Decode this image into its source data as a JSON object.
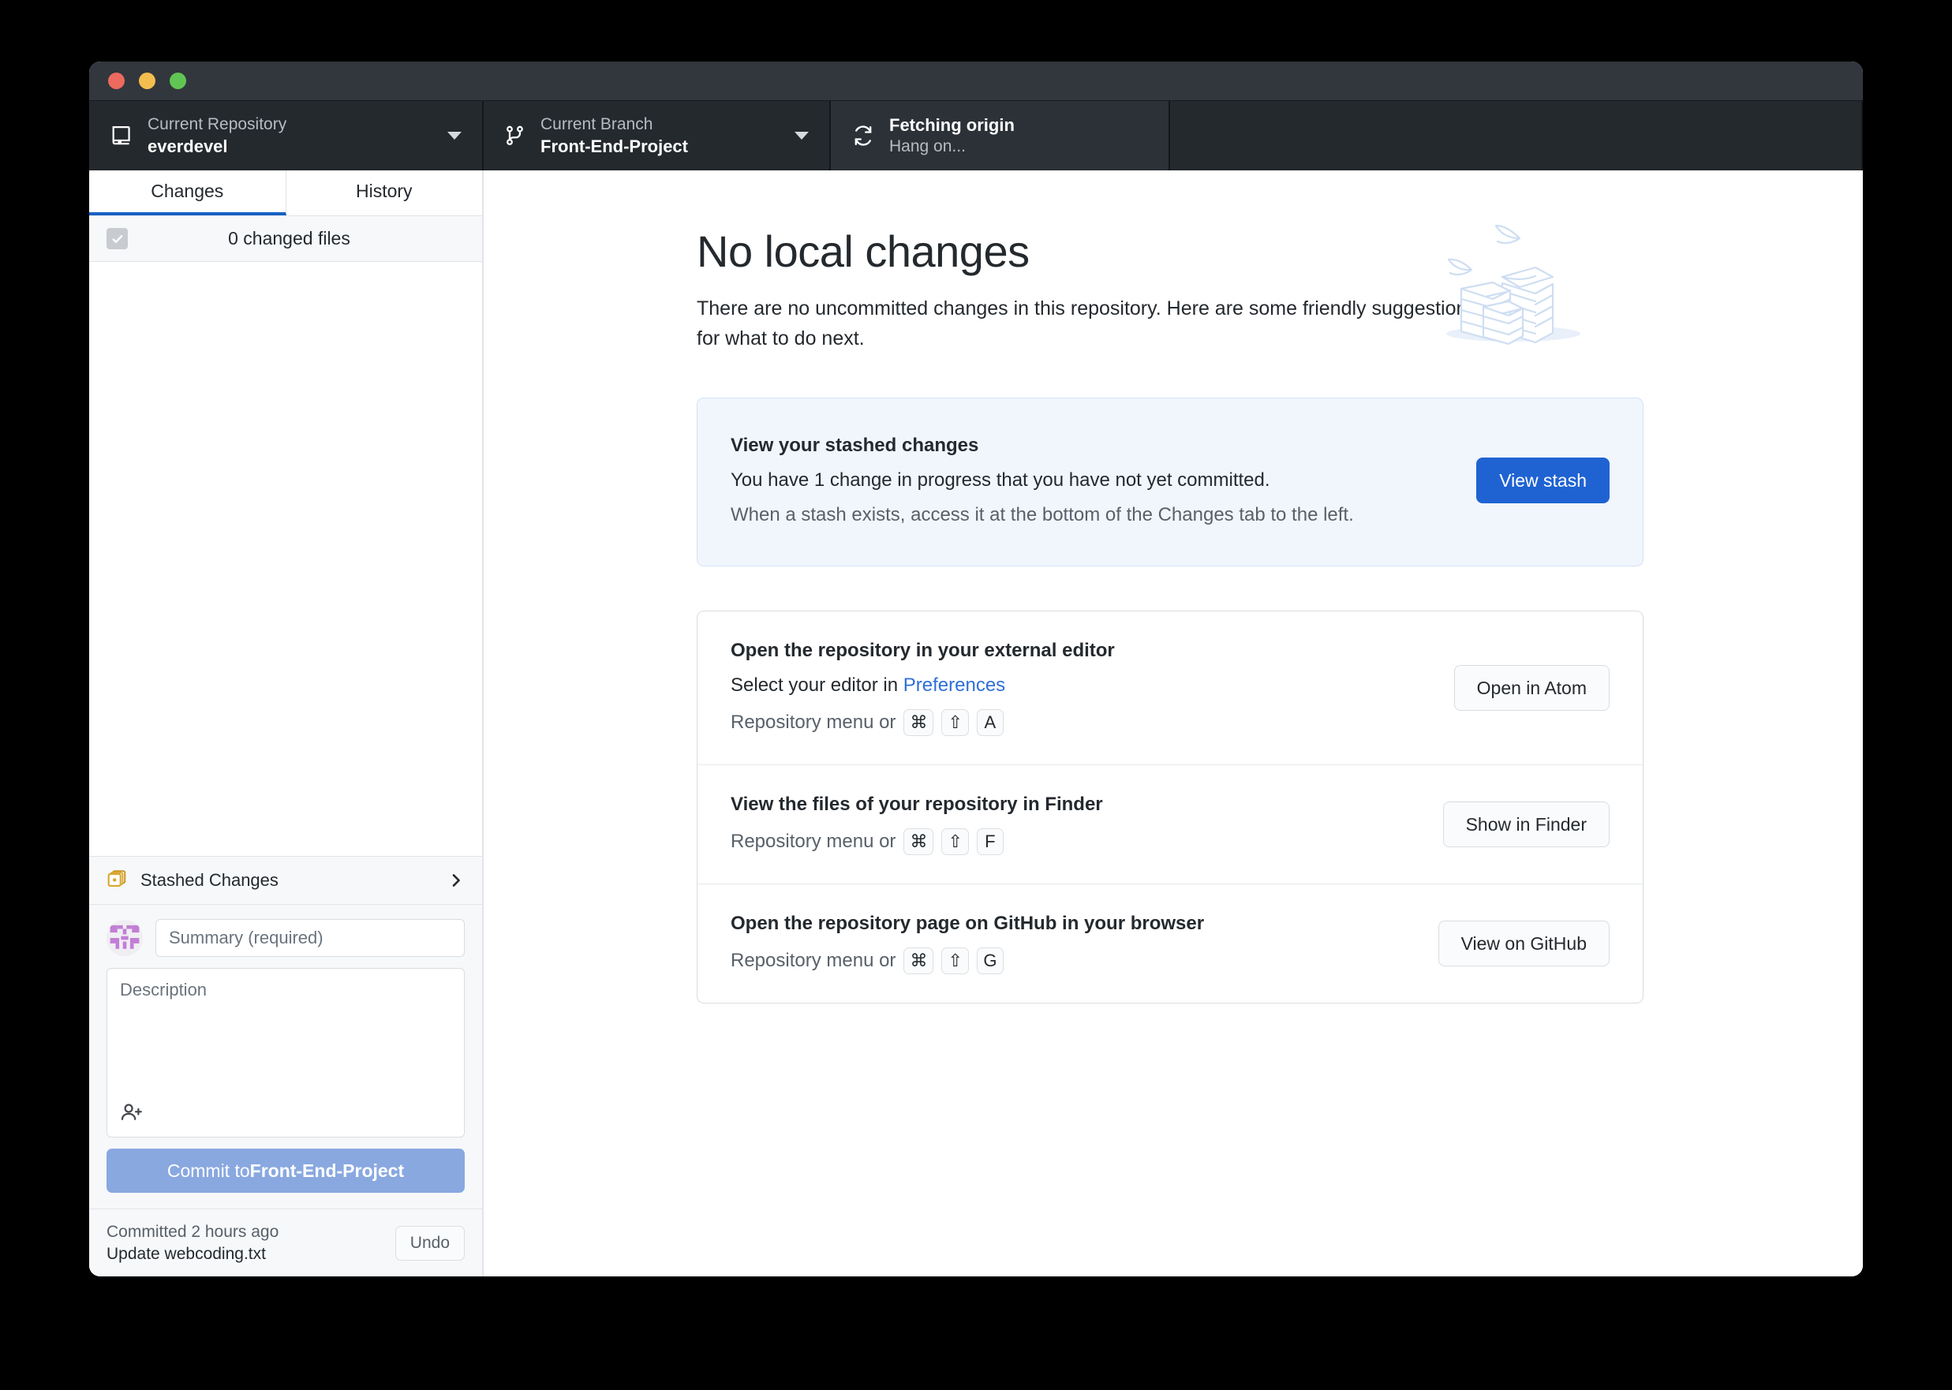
{
  "window": {
    "traffic_lights": [
      "close",
      "minimize",
      "zoom"
    ]
  },
  "toolbar": {
    "repository": {
      "label": "Current Repository",
      "value": "everdevel",
      "icon": "repo-icon",
      "caret": "chevron-down-icon"
    },
    "branch": {
      "label": "Current Branch",
      "value": "Front-End-Project",
      "icon": "branch-icon",
      "caret": "chevron-down-icon"
    },
    "fetch": {
      "title": "Fetching origin",
      "subtitle": "Hang on...",
      "icon": "sync-icon"
    }
  },
  "sidebar": {
    "tabs": [
      {
        "label": "Changes",
        "active": true
      },
      {
        "label": "History",
        "active": false
      }
    ],
    "changed_files_text": "0 changed files",
    "stashed": {
      "label": "Stashed Changes",
      "icon": "stash-icon",
      "chevron": "chevron-right-icon"
    },
    "commit": {
      "avatar": "avatar-identicon",
      "summary_placeholder": "Summary (required)",
      "summary_value": "",
      "description_placeholder": "Description",
      "description_value": "",
      "coauthor_icon": "add-coauthor-icon",
      "button_lead": "Commit to ",
      "button_branch": "Front-End-Project"
    },
    "footer": {
      "when": "Committed 2 hours ago",
      "message": "Update webcoding.txt",
      "undo_label": "Undo"
    }
  },
  "main": {
    "title": "No local changes",
    "subtitle": "There are no uncommitted changes in this repository. Here are some friendly suggestions for what to do next.",
    "illustration": "paper-stacks-illustration",
    "stash_card": {
      "title": "View your stashed changes",
      "description": "You have 1 change in progress that you have not yet committed.",
      "hint": "When a stash exists, access it at the bottom of the Changes tab to the left.",
      "button": "View stash"
    },
    "suggestions": [
      {
        "title": "Open the repository in your external editor",
        "desc_prefix": "Select your editor in ",
        "desc_link": "Preferences",
        "hint_prefix": "Repository menu or ",
        "keys": [
          "⌘",
          "⇧",
          "A"
        ],
        "button": "Open in Atom"
      },
      {
        "title": "View the files of your repository in Finder",
        "hint_prefix": "Repository menu or ",
        "keys": [
          "⌘",
          "⇧",
          "F"
        ],
        "button": "Show in Finder"
      },
      {
        "title": "Open the repository page on GitHub in your browser",
        "hint_prefix": "Repository menu or ",
        "keys": [
          "⌘",
          "⇧",
          "G"
        ],
        "button": "View on GitHub"
      }
    ]
  },
  "colors": {
    "toolbar_bg": "#24292e",
    "titlebar_bg": "#32373d",
    "accent_blue": "#1f63d2",
    "tab_underline": "#1661c4",
    "link_blue": "#2f6fd8",
    "commit_button": "#89a8e0",
    "stash_icon": "#d8a72e",
    "avatar_purple": "#c17fd6",
    "illustration": "#cedef2"
  }
}
